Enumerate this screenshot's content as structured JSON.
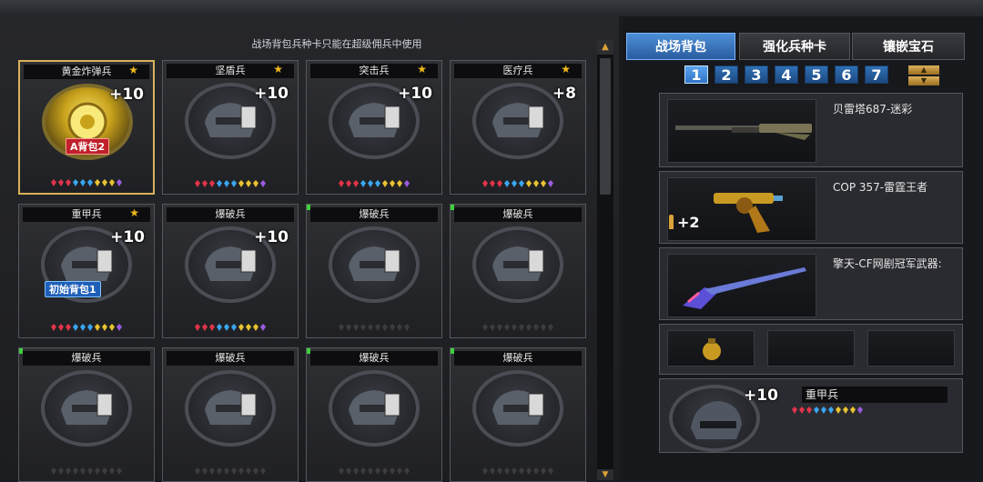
{
  "notice": "战场背包兵种卡只能在超级佣兵中使用",
  "cards": [
    {
      "title": "黄金炸弹兵",
      "star": true,
      "bonus": "+10",
      "tag": "A背包2",
      "tag_style": "red",
      "gold": true,
      "selected": true,
      "gems_active": true,
      "green": false
    },
    {
      "title": "坚盾兵",
      "star": true,
      "bonus": "+10",
      "tag": "",
      "gems_active": true,
      "green": false
    },
    {
      "title": "突击兵",
      "star": true,
      "bonus": "+10",
      "tag": "",
      "gems_active": true,
      "green": false
    },
    {
      "title": "医疗兵",
      "star": true,
      "bonus": "+8",
      "tag": "",
      "gems_active": true,
      "green": false
    },
    {
      "title": "重甲兵",
      "star": true,
      "bonus": "+10",
      "tag": "初始背包1",
      "tag_style": "blue",
      "gems_active": true,
      "green": false
    },
    {
      "title": "爆破兵",
      "star": false,
      "bonus": "+10",
      "tag": "",
      "gems_active": true,
      "green": false
    },
    {
      "title": "爆破兵",
      "star": false,
      "bonus": "",
      "tag": "",
      "gems_active": false,
      "green": true
    },
    {
      "title": "爆破兵",
      "star": false,
      "bonus": "",
      "tag": "",
      "gems_active": false,
      "green": true
    },
    {
      "title": "爆破兵",
      "star": false,
      "bonus": "",
      "tag": "",
      "gems_active": false,
      "green": true
    },
    {
      "title": "爆破兵",
      "star": false,
      "bonus": "",
      "tag": "",
      "gems_active": false,
      "green": false
    },
    {
      "title": "爆破兵",
      "star": false,
      "bonus": "",
      "tag": "",
      "gems_active": false,
      "green": true
    },
    {
      "title": "爆破兵",
      "star": false,
      "bonus": "",
      "tag": "",
      "gems_active": false,
      "green": true
    }
  ],
  "tabs": [
    {
      "label": "战场背包",
      "active": true
    },
    {
      "label": "强化兵种卡",
      "active": false
    },
    {
      "label": "镶嵌宝石",
      "active": false
    }
  ],
  "pages": [
    "1",
    "2",
    "3",
    "4",
    "5",
    "6",
    "7"
  ],
  "current_page": "1",
  "loadout": {
    "primary": {
      "name": "贝雷塔687-迷彩"
    },
    "secondary": {
      "name": "COP 357-雷霆王者",
      "ammo": "+2"
    },
    "melee": {
      "name": "擎天-CF网剧冠军武器:"
    },
    "hero": {
      "name": "重甲兵",
      "bonus": "+10"
    }
  },
  "colors": {
    "accent": "#4d8fd6",
    "star": "#f0b81a",
    "selected_border": "#d9b25a"
  }
}
